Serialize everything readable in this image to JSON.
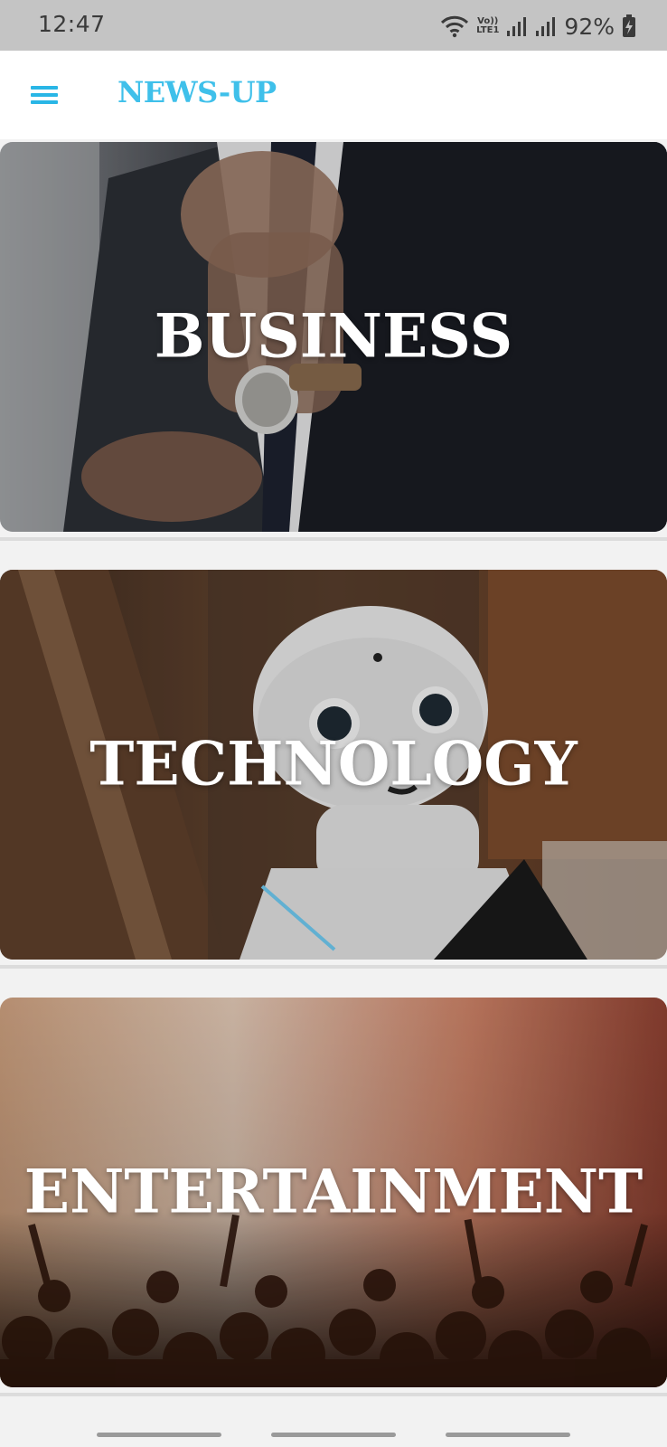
{
  "status_bar": {
    "time": "12:47",
    "lte_top": "Vo))",
    "lte_bottom": "LTE1",
    "battery": "92%"
  },
  "app_bar": {
    "title": "NEWS-UP",
    "menu_icon": "hamburger-menu-icon"
  },
  "categories": [
    {
      "label": "BUSINESS"
    },
    {
      "label": "TECHNOLOGY"
    },
    {
      "label": "ENTERTAINMENT"
    }
  ],
  "colors": {
    "accent": "#3fc0ea",
    "status_bar_bg": "#c4c4c4",
    "card_text": "#ffffff"
  }
}
